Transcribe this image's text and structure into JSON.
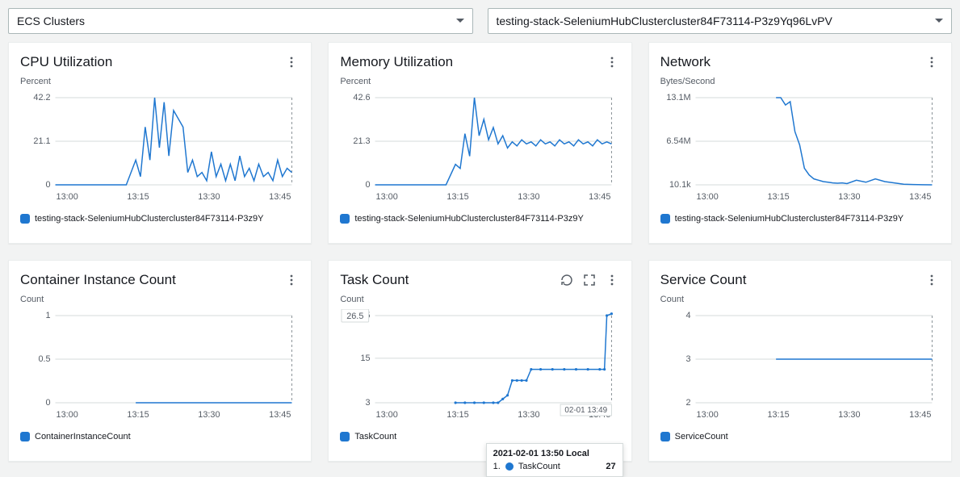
{
  "dropdowns": {
    "left": "ECS Clusters",
    "right": "testing-stack-SeleniumHubClustercluster84F73114-P3z9Yq96LvPV"
  },
  "legendSeries": "testing-stack-SeleniumHubClustercluster84F73114-P3z9Y",
  "timelabel": "02-01 13:49",
  "tooltip": {
    "title": "2021-02-01 13:50 Local",
    "idx": "1.",
    "name": "TaskCount",
    "value": "27"
  },
  "panels": [
    {
      "title": "CPU Utilization",
      "unit": "Percent",
      "legend": "series",
      "actions": [
        "more"
      ]
    },
    {
      "title": "Memory Utilization",
      "unit": "Percent",
      "legend": "series",
      "actions": [
        "more"
      ]
    },
    {
      "title": "Network",
      "unit": "Bytes/Second",
      "legend": "series",
      "actions": [
        "more"
      ]
    },
    {
      "title": "Container Instance Count",
      "unit": "Count",
      "legend": "ContainerInstanceCount",
      "actions": [
        "more"
      ]
    },
    {
      "title": "Task Count",
      "unit": "Count",
      "legend": "TaskCount",
      "actions": [
        "refresh",
        "expand",
        "more"
      ],
      "tooltip": true,
      "badge": "26.5"
    },
    {
      "title": "Service Count",
      "unit": "Count",
      "legend": "ServiceCount",
      "actions": [
        "more"
      ]
    }
  ],
  "chart_data": [
    {
      "type": "line",
      "title": "CPU Utilization",
      "ylabel": "Percent",
      "yticks": [
        0,
        21.1,
        42.2
      ],
      "ylim": [
        0,
        42.2
      ],
      "xticks": [
        "13:00",
        "13:15",
        "13:30",
        "13:45"
      ],
      "series": [
        {
          "name": "testing-stack-SeleniumHubClustercluster84F73114-P3z9Y",
          "x": [
            0.0,
            0.05,
            0.1,
            0.15,
            0.2,
            0.25,
            0.27,
            0.3,
            0.34,
            0.36,
            0.38,
            0.4,
            0.42,
            0.44,
            0.46,
            0.48,
            0.5,
            0.52,
            0.54,
            0.56,
            0.58,
            0.6,
            0.62,
            0.64,
            0.66,
            0.68,
            0.7,
            0.72,
            0.74,
            0.76,
            0.78,
            0.8,
            0.82,
            0.84,
            0.86,
            0.88,
            0.9,
            0.92,
            0.94,
            0.96,
            0.98,
            1.0
          ],
          "y": [
            0,
            0,
            0,
            0,
            0,
            0,
            0,
            0,
            12,
            4,
            28,
            12,
            42.2,
            18,
            40,
            14,
            36,
            32,
            28,
            6,
            12,
            4,
            6,
            2,
            16,
            4,
            10,
            2,
            10,
            2,
            14,
            4,
            8,
            2,
            10,
            4,
            6,
            2,
            12,
            4,
            8,
            6
          ]
        }
      ]
    },
    {
      "type": "line",
      "title": "Memory Utilization",
      "ylabel": "Percent",
      "yticks": [
        0,
        21.3,
        42.6
      ],
      "ylim": [
        0,
        42.6
      ],
      "xticks": [
        "13:00",
        "13:15",
        "13:30",
        "13:45"
      ],
      "series": [
        {
          "name": "testing-stack-SeleniumHubClustercluster84F73114-P3z9Y",
          "x": [
            0.0,
            0.05,
            0.1,
            0.15,
            0.2,
            0.25,
            0.3,
            0.34,
            0.36,
            0.38,
            0.4,
            0.42,
            0.44,
            0.46,
            0.48,
            0.5,
            0.52,
            0.54,
            0.56,
            0.58,
            0.6,
            0.62,
            0.64,
            0.66,
            0.68,
            0.7,
            0.72,
            0.74,
            0.76,
            0.78,
            0.8,
            0.82,
            0.84,
            0.86,
            0.88,
            0.9,
            0.92,
            0.94,
            0.96,
            0.98,
            1.0
          ],
          "y": [
            0,
            0,
            0,
            0,
            0,
            0,
            0,
            10,
            8,
            25,
            14,
            42.6,
            24,
            32,
            22,
            28,
            20,
            24,
            18,
            21,
            19,
            22,
            20,
            21,
            19,
            22,
            20,
            21,
            19,
            22,
            20,
            21,
            19,
            22,
            20,
            21,
            19,
            22,
            20,
            21,
            20
          ]
        }
      ]
    },
    {
      "type": "line",
      "title": "Network",
      "ylabel": "Bytes/Second",
      "yticks": [
        "10.1k",
        "6.54M",
        "13.1M"
      ],
      "ylim": [
        10100,
        13100000
      ],
      "xticks": [
        "13:00",
        "13:15",
        "13:30",
        "13:45"
      ],
      "series": [
        {
          "name": "testing-stack-SeleniumHubClustercluster84F73114-P3z9Y",
          "x": [
            0.34,
            0.36,
            0.38,
            0.4,
            0.42,
            0.44,
            0.46,
            0.48,
            0.5,
            0.52,
            0.54,
            0.56,
            0.58,
            0.6,
            0.62,
            0.64,
            0.68,
            0.72,
            0.76,
            0.8,
            0.84,
            0.88,
            0.92,
            0.96,
            1.0
          ],
          "y": [
            13100000,
            13100000,
            12000000,
            12500000,
            8000000,
            6000000,
            2500000,
            1500000,
            900000,
            700000,
            500000,
            400000,
            300000,
            250000,
            300000,
            200000,
            700000,
            400000,
            900000,
            500000,
            300000,
            100000,
            50000,
            30000,
            10100
          ]
        }
      ]
    },
    {
      "type": "line",
      "title": "Container Instance Count",
      "ylabel": "Count",
      "yticks": [
        0,
        0.5,
        1
      ],
      "ylim": [
        0,
        1
      ],
      "xticks": [
        "13:00",
        "13:15",
        "13:30",
        "13:45"
      ],
      "series": [
        {
          "name": "ContainerInstanceCount",
          "x": [
            0.34,
            0.4,
            0.5,
            0.6,
            0.7,
            0.8,
            0.9,
            1.0
          ],
          "y": [
            0,
            0,
            0,
            0,
            0,
            0,
            0,
            0
          ]
        }
      ]
    },
    {
      "type": "line",
      "title": "Task Count",
      "ylabel": "Count",
      "yticks": [
        3,
        15,
        26.5
      ],
      "ylim": [
        3,
        26.5
      ],
      "xticks": [
        "13:00",
        "13:15",
        "13:30",
        "13:45"
      ],
      "series": [
        {
          "name": "TaskCount",
          "x": [
            0.34,
            0.38,
            0.42,
            0.46,
            0.5,
            0.52,
            0.54,
            0.56,
            0.58,
            0.6,
            0.62,
            0.64,
            0.66,
            0.7,
            0.75,
            0.8,
            0.85,
            0.9,
            0.95,
            0.97,
            0.98,
            1.0
          ],
          "y": [
            3,
            3,
            3,
            3,
            3,
            3,
            4,
            5,
            9,
            9,
            9,
            9,
            12,
            12,
            12,
            12,
            12,
            12,
            12,
            12,
            26.5,
            27
          ],
          "dotted": true
        }
      ]
    },
    {
      "type": "line",
      "title": "Service Count",
      "ylabel": "Count",
      "yticks": [
        2,
        3,
        4
      ],
      "ylim": [
        2,
        4
      ],
      "xticks": [
        "13:00",
        "13:15",
        "13:30",
        "13:45"
      ],
      "series": [
        {
          "name": "ServiceCount",
          "x": [
            0.34,
            0.4,
            0.5,
            0.6,
            0.7,
            0.8,
            0.9,
            1.0
          ],
          "y": [
            3,
            3,
            3,
            3,
            3,
            3,
            3,
            3
          ]
        }
      ]
    }
  ]
}
